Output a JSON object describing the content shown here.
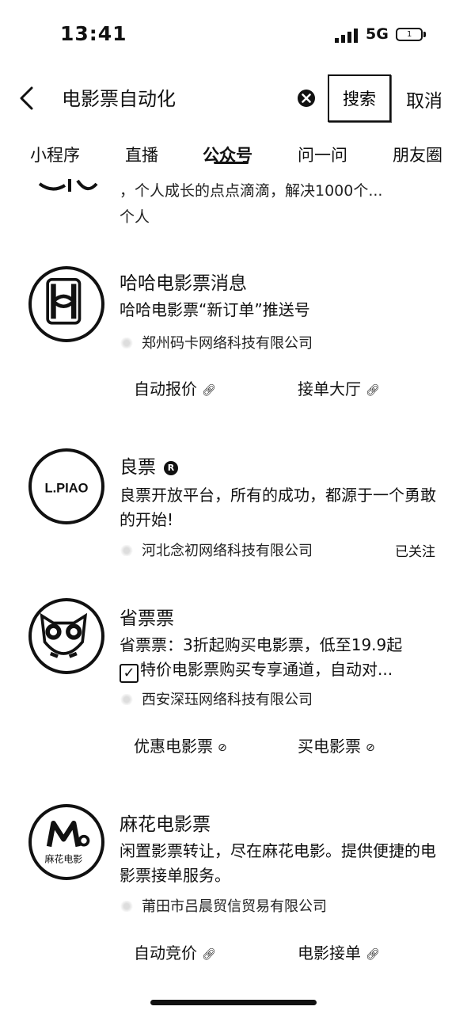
{
  "status_bar": {
    "time": "13:41",
    "network": "5G",
    "battery": "1"
  },
  "search": {
    "query": "电影票自动化",
    "button_label": "搜索",
    "cancel_label": "取消"
  },
  "tabs": [
    {
      "label": "小程序"
    },
    {
      "label": "直播"
    },
    {
      "label": "公众号"
    },
    {
      "label": "问一问"
    },
    {
      "label": "朋友圈"
    }
  ],
  "active_tab": "公众号",
  "partial_result": {
    "text": "，个人成长的点点滴滴，解决1000个...",
    "owner": "个人"
  },
  "results": [
    {
      "name": "哈哈电影票消息",
      "description": "哈哈电影票“新订单”推送号",
      "owner": "郑州码卡网络科技有限公司",
      "links": [
        "自动报价",
        "接单大厅"
      ]
    },
    {
      "name": "良票",
      "verified_badge": "R",
      "description": "良票开放平台，所有的成功，都源于一个勇敢的开始!",
      "owner": "河北念初网络科技有限公司",
      "follow_status": "已关注",
      "logo_text": "L.PIAO"
    },
    {
      "name": "省票票",
      "description_line1": "省票票：3折起购买电影票，低至19.9起",
      "description_line2": "特价电影票购买专享通道，自动对...",
      "owner": "西安深珏网络科技有限公司",
      "links": [
        "优惠电影票",
        "买电影票"
      ]
    },
    {
      "name": "麻花电影票",
      "description": "闲置影票转让，尽在麻花电影。提供便捷的电影票接单服务。",
      "owner": "莆田市吕晨贸信贸易有限公司",
      "links": [
        "自动竞价",
        "电影接单"
      ],
      "logo_text": "麻花电影"
    }
  ]
}
